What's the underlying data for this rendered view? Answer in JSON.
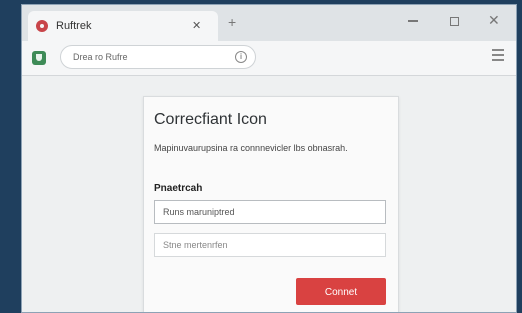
{
  "browser": {
    "tab": {
      "title": "Ruftrek"
    },
    "address_bar": {
      "url": "Drea ro Rufre"
    }
  },
  "dialog": {
    "title": "Correcfiant Icon",
    "message": "Mapinuvaurupsina ra connnevicler lbs obnasrah.",
    "field_label": "Pnaetrcah",
    "field_1_placeholder": "Runs maruniptred",
    "field_2_placeholder": "Stne mertenrfen",
    "connect_button": "Connet"
  },
  "colors": {
    "accent": "#d94241",
    "favicon": "#c8454a",
    "shield": "#3e8b57"
  },
  "icons": [
    "favicon-icon",
    "close-icon",
    "new-tab-icon",
    "minimize-icon",
    "maximize-icon",
    "window-close-icon",
    "shield-icon",
    "info-icon",
    "menu-icon"
  ]
}
